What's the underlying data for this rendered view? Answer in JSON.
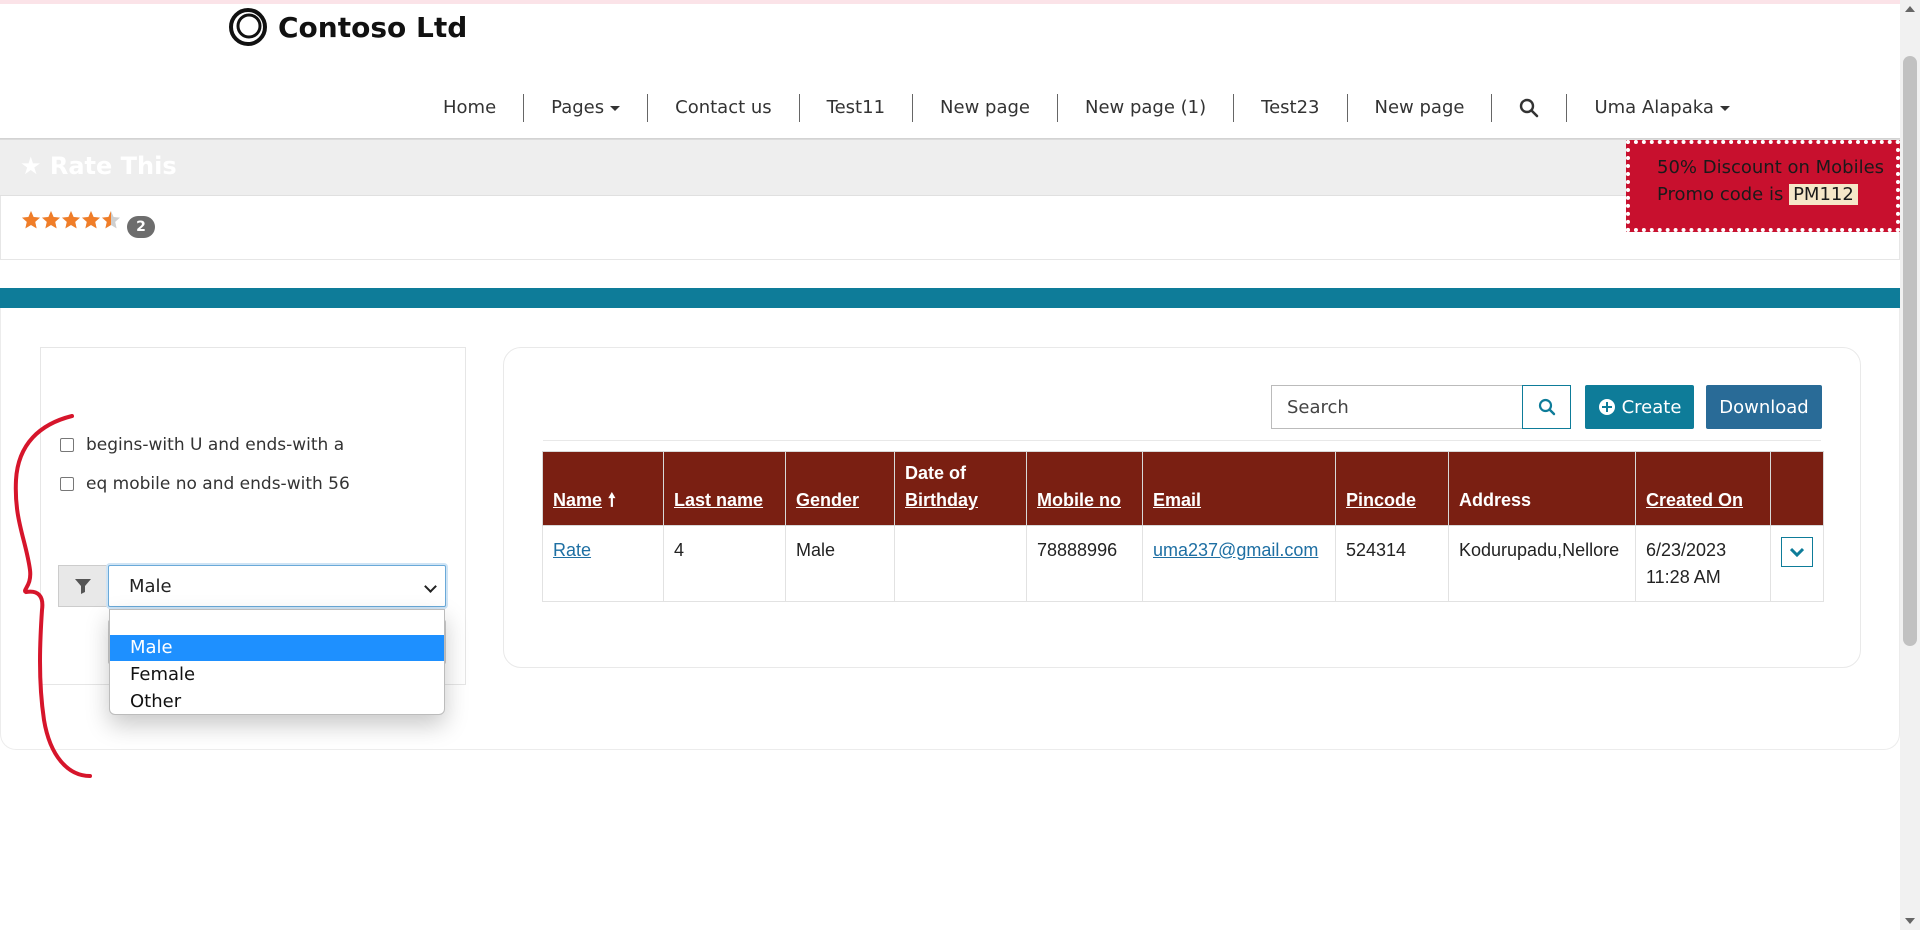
{
  "brand": {
    "name": "Contoso Ltd"
  },
  "nav": {
    "items": [
      {
        "label": "Home",
        "has_caret": false
      },
      {
        "label": "Pages",
        "has_caret": true
      },
      {
        "label": "Contact us",
        "has_caret": false
      },
      {
        "label": "Test11",
        "has_caret": false
      },
      {
        "label": "New page",
        "has_caret": false
      },
      {
        "label": "New page (1)",
        "has_caret": false
      },
      {
        "label": "Test23",
        "has_caret": false
      },
      {
        "label": "New page",
        "has_caret": false
      }
    ],
    "search_icon": "search-icon",
    "user_label": "Uma Alapaka"
  },
  "rating": {
    "title": "Rate This",
    "stars_value": 4.5,
    "stars_max": 5,
    "count": "2"
  },
  "promo": {
    "line1": "50% Discount on Mobiles",
    "line2": "Promo code is",
    "code": "PM112"
  },
  "filters": {
    "options": [
      {
        "label": "begins-with U and ends-with a",
        "checked": false
      },
      {
        "label": "eq mobile no and ends-with 56",
        "checked": false
      }
    ],
    "select": {
      "value": "Male",
      "options": [
        "",
        "Male",
        "Female",
        "Other"
      ],
      "highlighted": "Male"
    }
  },
  "toolbar": {
    "search_placeholder": "Search",
    "create_label": "Create",
    "download_label": "Download"
  },
  "grid": {
    "columns": [
      {
        "line1": "Name",
        "line2": "",
        "sortable": true,
        "sorted": "asc"
      },
      {
        "line1": "Last name",
        "line2": "",
        "sortable": true
      },
      {
        "line1": "Gender",
        "line2": "",
        "sortable": true
      },
      {
        "line1": "Date of",
        "line2": "Birthday",
        "sortable": true
      },
      {
        "line1": "Mobile no",
        "line2": "",
        "sortable": true
      },
      {
        "line1": "Email",
        "line2": "",
        "sortable": true
      },
      {
        "line1": "Pincode",
        "line2": "",
        "sortable": true
      },
      {
        "line1": "Address",
        "line2": "",
        "sortable": false
      },
      {
        "line1": "Created On",
        "line2": "",
        "sortable": true
      }
    ],
    "rows": [
      {
        "name": "Rate",
        "last_name": "4",
        "gender": "Male",
        "dob": "",
        "mobile": "78888996",
        "email": "uma237@gmail.com",
        "pincode": "524314",
        "address": "Kodurupadu,Nellore",
        "created_date": "6/23/2023",
        "created_time": "11:28 AM"
      }
    ]
  },
  "colors": {
    "teal": "#0e7c99",
    "grid_header": "#7a1f12",
    "promo_bg": "#c8102e",
    "star": "#f07d28",
    "annotation": "#d6152b"
  }
}
